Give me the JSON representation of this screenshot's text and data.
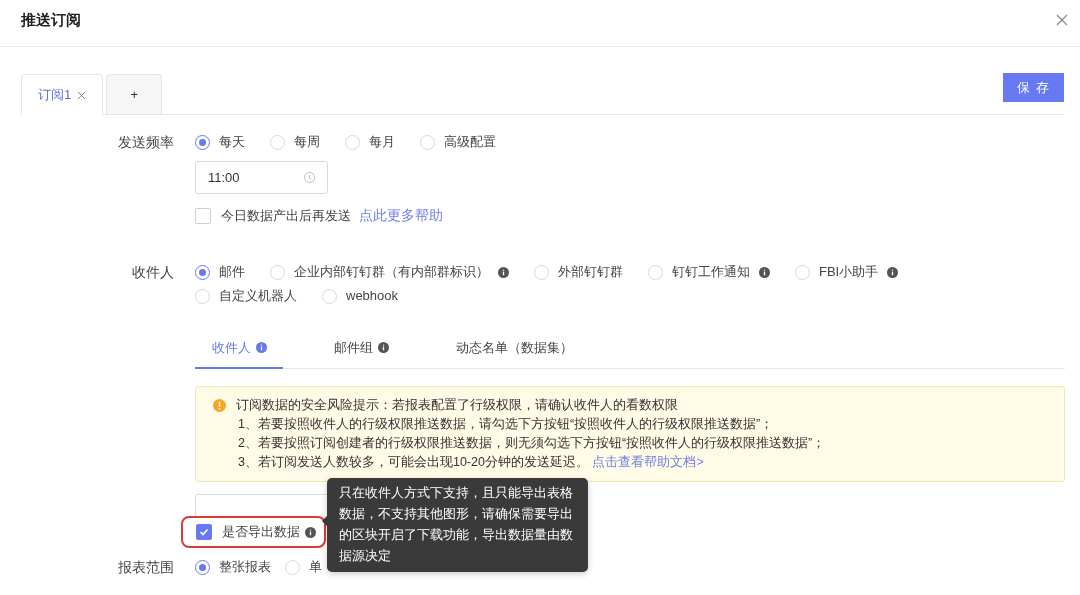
{
  "dialog": {
    "title": "推送订阅"
  },
  "tabs": [
    {
      "label": "订阅1",
      "selected": true,
      "closable": true
    },
    {
      "label": "+",
      "selected": false,
      "closable": false
    }
  ],
  "save_button": "保 存",
  "frequency": {
    "label": "发送频率",
    "options": [
      {
        "label": "每天",
        "selected": true
      },
      {
        "label": "每周",
        "selected": false
      },
      {
        "label": "每月",
        "selected": false
      },
      {
        "label": "高级配置",
        "selected": false
      }
    ],
    "time": "11:00",
    "wait_checkbox": {
      "label": "今日数据产出后再发送",
      "checked": false
    },
    "help_link": "点此更多帮助"
  },
  "recipients": {
    "label": "收件人",
    "options": [
      {
        "label": "邮件",
        "selected": true,
        "info": false
      },
      {
        "label": "企业内部钉钉群（有内部群标识）",
        "selected": false,
        "info": true
      },
      {
        "label": "外部钉钉群",
        "selected": false,
        "info": false
      },
      {
        "label": "钉钉工作通知",
        "selected": false,
        "info": true
      },
      {
        "label": "FBI小助手",
        "selected": false,
        "info": true
      },
      {
        "label": "自定义机器人",
        "selected": false,
        "info": false
      },
      {
        "label": "webhook",
        "selected": false,
        "info": false
      }
    ],
    "subtabs": [
      {
        "label": "收件人",
        "selected": true,
        "info": true
      },
      {
        "label": "邮件组",
        "selected": false,
        "info": true
      },
      {
        "label": "动态名单（数据集）",
        "selected": false,
        "info": false
      }
    ],
    "alert": {
      "title": "订阅数据的安全风险提示：若报表配置了行级权限，请确认收件人的看数权限",
      "lines": [
        "1、若要按照收件人的行级权限推送数据，请勾选下方按钮“按照收件人的行级权限推送数据”；",
        "2、若要按照订阅创建者的行级权限推送数据，则无须勾选下方按钮“按照收件人的行级权限推送数据”；",
        "3、若订阅发送人数较多，可能会出现10-20分钟的发送延迟。"
      ],
      "link": "点击查看帮助文档>"
    },
    "export": {
      "label": "是否导出数据",
      "checked": true,
      "info": true,
      "highlighted": true
    },
    "tooltip": "只在收件人方式下支持，且只能导出表格数据，不支持其他图形，请确保需要导出的区块开启了下载功能，导出数据量由数据源决定"
  },
  "report_scope": {
    "label": "报表范围",
    "options": [
      {
        "label": "整张报表",
        "selected": true
      },
      {
        "label": "单",
        "selected": false
      }
    ]
  }
}
